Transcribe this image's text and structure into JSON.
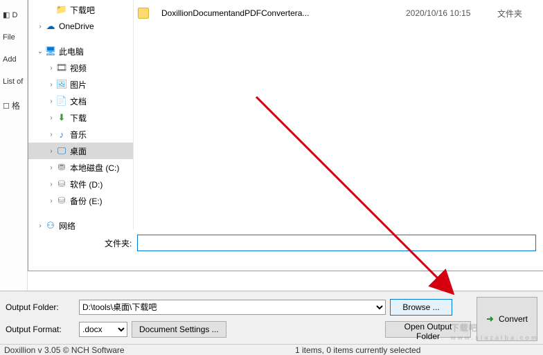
{
  "leftStrip": {
    "file": "File",
    "add": "Add",
    "listOf": "List of",
    "fmt": "格"
  },
  "tree": {
    "downloads_cn": "下载吧",
    "onedrive": "OneDrive",
    "thispc": "此电脑",
    "video": "视频",
    "pictures": "图片",
    "documents": "文档",
    "downloads": "下载",
    "music": "音乐",
    "desktop": "桌面",
    "localc": "本地磁盘 (C:)",
    "softd": "软件 (D:)",
    "backupe": "备份 (E:)",
    "network": "网络"
  },
  "fileList": {
    "name": "DoxillionDocumentandPDFConvertera...",
    "date": "2020/10/16 10:15",
    "type": "文件夹"
  },
  "dialog": {
    "folderLabel": "文件夹:",
    "folderValue": ""
  },
  "bottom": {
    "outFolderLabel": "Output Folder:",
    "outFolderValue": "D:\\tools\\桌面\\下载吧",
    "browse": "Browse ...",
    "outFormatLabel": "Output Format:",
    "outFormatValue": ".docx",
    "docSettings": "Document Settings ...",
    "openOut": "Open Output Folder",
    "convert": "Convert"
  },
  "status": {
    "left": "Doxillion v 3.05  © NCH Software",
    "right": "1 items, 0 items currently selected"
  },
  "watermark": {
    "big": "下载吧",
    "small": "www.xiazaiba.com"
  }
}
